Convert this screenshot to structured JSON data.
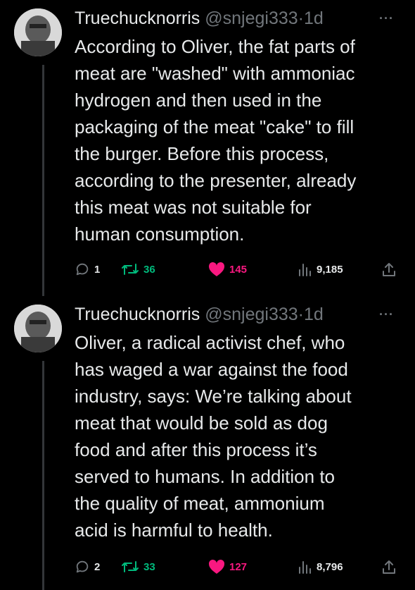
{
  "tweets": [
    {
      "name": "Truechucknorris",
      "handle": "@snjegi333",
      "separator": "·",
      "time": "1d",
      "text": "According to Oliver, the fat parts of\nmeat are \"washed\" with ammoniac\nhydrogen and then used in the\npackaging of the meat \"cake\" to fill\nthe burger. Before this process,\naccording to the presenter, already\nthis meat was not suitable for\nhuman consumption.",
      "replies": "1",
      "retweets": "36",
      "likes": "145",
      "views": "9,185"
    },
    {
      "name": "Truechucknorris",
      "handle": "@snjegi333",
      "separator": "·",
      "time": "1d",
      "text": "Oliver, a radical activist chef, who\nhas waged a war against the food\nindustry, says: We’re talking about\nmeat that would be sold as dog\nfood and after this process it’s\nserved to humans. In addition to\nthe quality of meat, ammonium\nacid is harmful to health.",
      "replies": "2",
      "retweets": "33",
      "likes": "127",
      "views": "8,796"
    }
  ],
  "more_label": "···",
  "colors": {
    "background": "#000000",
    "text": "#e7e9ea",
    "secondary": "#71767b",
    "retweet_active": "#00ba7c",
    "like_active": "#f91880"
  },
  "icons": [
    "reply-icon",
    "retweet-icon",
    "like-icon",
    "views-icon",
    "share-icon",
    "more-icon"
  ]
}
